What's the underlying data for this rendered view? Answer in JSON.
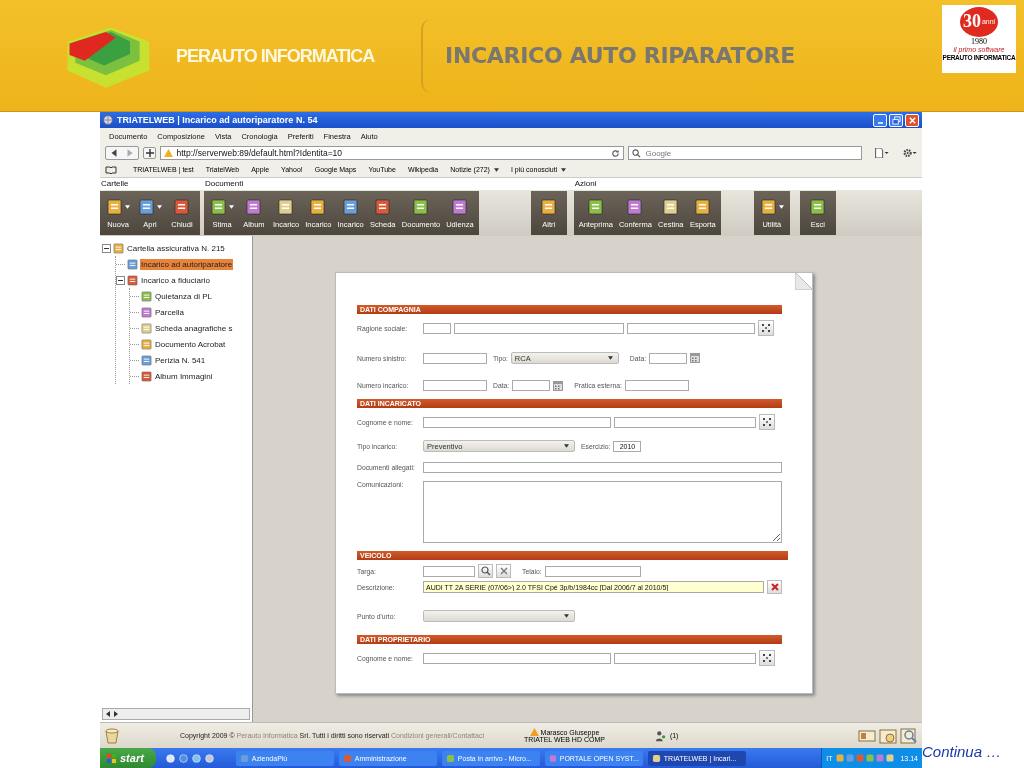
{
  "slide": {
    "brand": "PERAUTO INFORMATICA",
    "title": "INCARICO AUTO RIPARATORE",
    "badge": {
      "number": "30",
      "unit": "anni",
      "year": "1980",
      "tagline": "il primo software",
      "maker": "PERAUTO INFORMATICA"
    },
    "continue": "Continua …"
  },
  "window": {
    "title": "TRIATELWEB | Incarico ad autoriparatore N. 54"
  },
  "menu": [
    "Documento",
    "Composizione",
    "Vista",
    "Cronologia",
    "Preferiti",
    "Finestra",
    "Aiuto"
  ],
  "address": {
    "url": "http://serverweb:89/default.html?Identita=10",
    "search_placeholder": "Google"
  },
  "bookmarks": [
    {
      "label": "TRIATELWEB | test",
      "menu": false
    },
    {
      "label": "TriatelWeb",
      "menu": false
    },
    {
      "label": "Apple",
      "menu": false
    },
    {
      "label": "Yahoo!",
      "menu": false
    },
    {
      "label": "Google Maps",
      "menu": false
    },
    {
      "label": "YouTube",
      "menu": false
    },
    {
      "label": "Wikipedia",
      "menu": false
    },
    {
      "label": "Notizie (272)",
      "menu": true
    },
    {
      "label": "I più conosciuti",
      "menu": true
    }
  ],
  "toolbar": [
    {
      "label": "Cartelle",
      "buttons": [
        {
          "label": "Nuova",
          "menu": true
        },
        {
          "label": "Apri",
          "menu": true
        },
        {
          "label": "Chiudi",
          "menu": false
        }
      ]
    },
    {
      "label": "Documenti",
      "buttons": [
        {
          "label": "Stima",
          "menu": true
        },
        {
          "label": "Album",
          "menu": false
        },
        {
          "label": "Incarico",
          "menu": false
        },
        {
          "label": "Incarico",
          "menu": false
        },
        {
          "label": "Incarico",
          "menu": false
        },
        {
          "label": "Scheda",
          "menu": false
        },
        {
          "label": "Documento",
          "menu": false
        },
        {
          "label": "Udienza",
          "menu": false
        }
      ]
    },
    {
      "buttons": [
        {
          "label": "Altri",
          "menu": false
        }
      ]
    },
    {
      "label": "Azioni",
      "buttons": [
        {
          "label": "Anteprima",
          "menu": false
        },
        {
          "label": "Conferma",
          "menu": false
        },
        {
          "label": "Cestina",
          "menu": false
        },
        {
          "label": "Esporta",
          "menu": false
        }
      ]
    },
    {
      "buttons": [
        {
          "label": "Utilità",
          "menu": true
        }
      ]
    },
    {
      "buttons": [
        {
          "label": "Esci",
          "menu": false
        }
      ]
    }
  ],
  "tree": {
    "label": "Cartella assicurativa N. 215",
    "expanded": true,
    "selected": false,
    "children": [
      {
        "label": "Incarico ad autoriparatore",
        "selected": true
      },
      {
        "label": "Incarico a fiduciario",
        "expanded": true,
        "selected": false,
        "children": [
          {
            "label": "Quietanza di PL",
            "selected": false
          },
          {
            "label": "Parcella",
            "selected": false
          },
          {
            "label": "Scheda anagrafiche s",
            "selected": false
          },
          {
            "label": "Documento Acrobat",
            "selected": false
          },
          {
            "label": "Perizia N. 541",
            "selected": false
          },
          {
            "label": "Album Immagini",
            "selected": false
          }
        ]
      }
    ]
  },
  "form": {
    "company": {
      "title": "DATI COMPAGNIA",
      "ragione_sociale": "Ragione sociale:",
      "numero_sinistro": "Numero sinistro:",
      "tipo": "Tipo:",
      "tipo_value": "RCA",
      "data": "Data:",
      "numero_incarico": "Numero incarico:",
      "data_incarico": "Data:",
      "pratica": "Pratica esterna:"
    },
    "assignee": {
      "title": "DATI INCARICATO",
      "name": "Cognome e nome:",
      "tipo_incarico": "Tipo incarico:",
      "tipo_value": "Preventivo",
      "esercizio": "Esercizio:",
      "esercizio_value": "2010",
      "allegati": "Documenti allegati:",
      "comunicazioni": "Comunicazioni:"
    },
    "vehicle": {
      "title": "VEICOLO",
      "targa": "Targa:",
      "telaio": "Telaio:",
      "descrizione": "Descrizione:",
      "descrizione_value": "AUDI TT 2A SERIE (07/06>) 2.0 TFSI Cpé 3p/b/1984cc [Dal 2006/7 al 2010/5]",
      "punto": "Punto d'urto:"
    },
    "owner": {
      "title": "DATI PROPRIETARIO",
      "name": "Cognome e nome:"
    }
  },
  "footer": {
    "copyright": "Copyright 2009 ©",
    "company_link": "Perauto Informatica",
    "rights": "Srl. Tutti i diritti sono riservati",
    "terms_link": "Condizioni generali/Contattaci",
    "user": "Marasco Giuseppe",
    "workstation": "TRIATEL WEB HD COMP",
    "users_count": "(1)"
  },
  "taskbar": {
    "start": "start",
    "tasks": [
      {
        "label": "AziendaPiù",
        "selected": false
      },
      {
        "label": "Amministrazione",
        "selected": false
      },
      {
        "label": "Posta in arrivo - Micro...",
        "selected": false
      },
      {
        "label": "PORTALE OPEN SYST...",
        "selected": false
      },
      {
        "label": "TRIATELWEB | Incari...",
        "selected": true
      }
    ],
    "language": "IT",
    "time": "13.14"
  }
}
